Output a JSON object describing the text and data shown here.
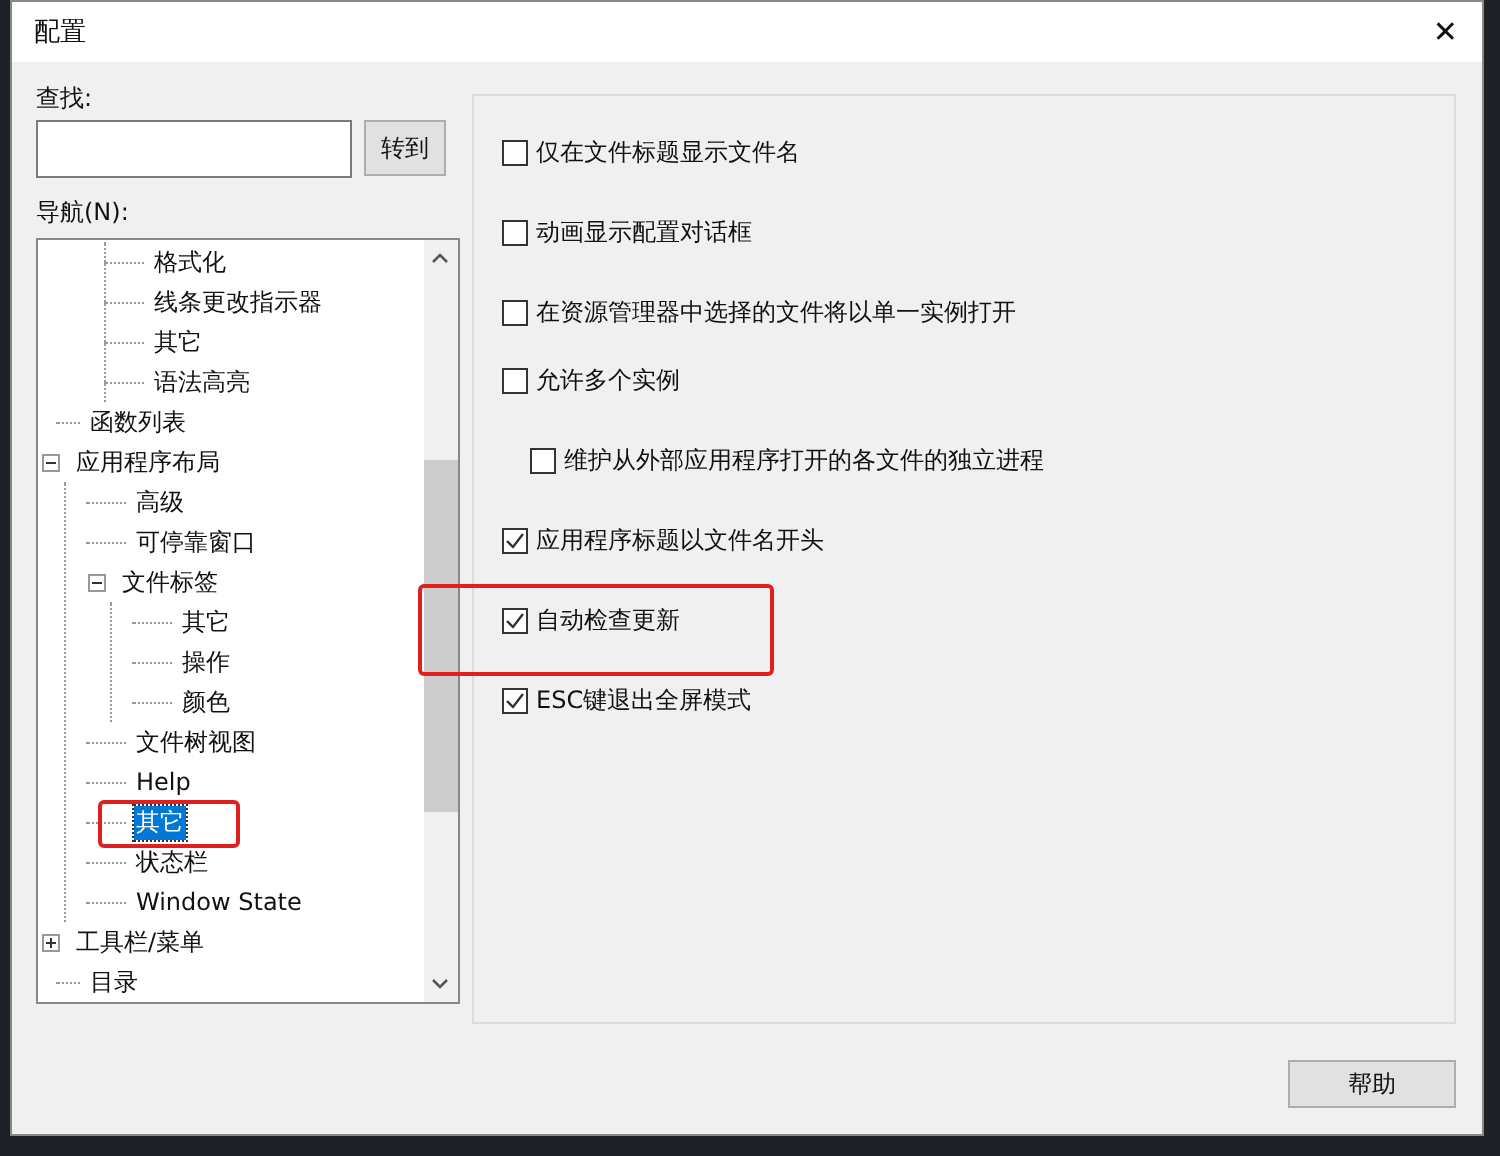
{
  "window": {
    "title": "配置",
    "close": "✕"
  },
  "search": {
    "label": "查找:",
    "button": "转到"
  },
  "navigation": {
    "label": "导航(N):",
    "tree": [
      {
        "children": [
          {
            "label": "格式化",
            "selected": false
          },
          {
            "label": "线条更改指示器",
            "selected": false
          },
          {
            "label": "其它",
            "selected": false
          },
          {
            "label": "语法高亮",
            "selected": false
          }
        ]
      },
      {
        "label": "函数列表",
        "selected": false
      },
      {
        "label": "应用程序布局",
        "selected": false,
        "expanded": true,
        "children": [
          {
            "label": "高级",
            "selected": false
          },
          {
            "label": "可停靠窗口",
            "selected": false
          },
          {
            "label": "文件标签",
            "selected": false,
            "expanded": true,
            "children": [
              {
                "label": "其它",
                "selected": false
              },
              {
                "label": "操作",
                "selected": false
              },
              {
                "label": "颜色",
                "selected": false
              }
            ]
          },
          {
            "label": "文件树视图",
            "selected": false
          },
          {
            "label": "Help",
            "selected": false
          },
          {
            "label": "其它",
            "selected": true
          },
          {
            "label": "状态栏",
            "selected": false
          },
          {
            "label": "Window State",
            "selected": false
          }
        ]
      },
      {
        "label": "工具栏/菜单",
        "selected": false,
        "expanded": false
      },
      {
        "label": "目录",
        "selected": false
      }
    ]
  },
  "options": [
    {
      "label": "仅在文件标题显示文件名",
      "checked": false
    },
    {
      "label": "动画显示配置对话框",
      "checked": false
    },
    {
      "label": "在资源管理器中选择的文件将以单一实例打开",
      "checked": false
    },
    {
      "label": "允许多个实例",
      "checked": false,
      "children": [
        {
          "label": "维护从外部应用程序打开的各文件的独立进程",
          "checked": false
        }
      ]
    },
    {
      "label": "应用程序标题以文件名开头",
      "checked": true
    },
    {
      "label": "自动检查更新",
      "checked": true
    },
    {
      "label": "ESC键退出全屏模式",
      "checked": true
    }
  ],
  "buttons": [
    "帮助"
  ]
}
